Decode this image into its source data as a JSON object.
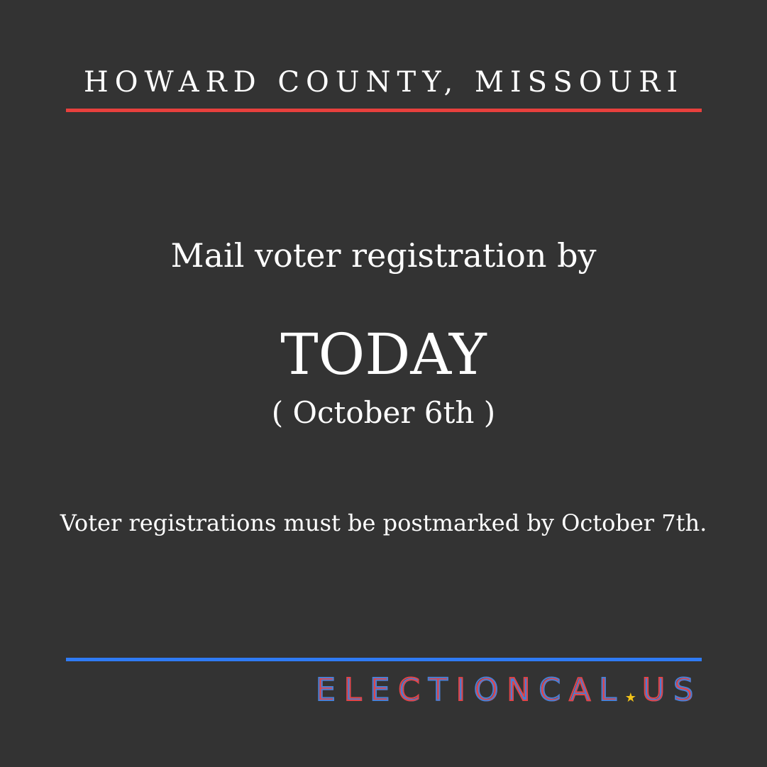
{
  "header": {
    "county": "HOWARD COUNTY, MISSOURI"
  },
  "main": {
    "headline": "Mail voter registration by",
    "deadline": "TODAY",
    "date": "( October 6th )",
    "note": "Voter registrations must be postmarked by October 7th."
  },
  "footer": {
    "logo_text": "ELECTIONCAL.US",
    "logo_icon": "star-icon"
  },
  "colors": {
    "background": "#333333",
    "accent_red": "#e8403d",
    "accent_blue": "#2f7bf5",
    "logo_blue": "#4a7fd4",
    "logo_red": "#e0454a",
    "star_yellow": "#f2c318",
    "text": "#ffffff"
  }
}
